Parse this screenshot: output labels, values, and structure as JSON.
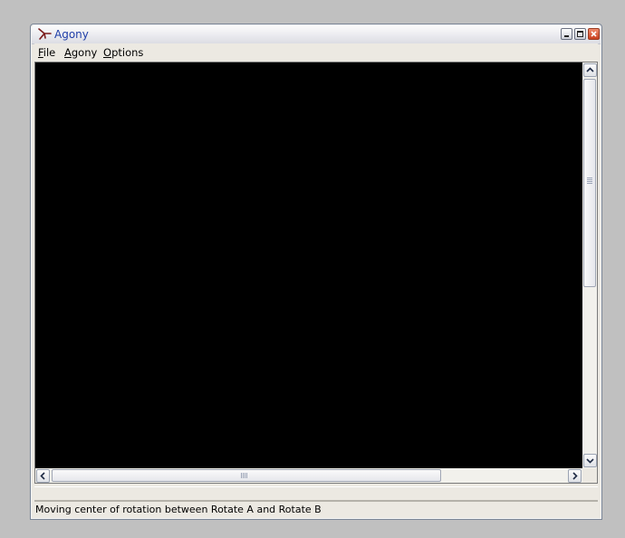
{
  "window": {
    "title": "Agony",
    "icon": "agony-app-icon"
  },
  "titlebar_buttons": {
    "minimize": "minimize-icon",
    "maximize": "maximize-icon",
    "close": "close-icon"
  },
  "menu": {
    "items": [
      {
        "accel": "F",
        "rest": "ile"
      },
      {
        "accel": "A",
        "rest": "gony"
      },
      {
        "accel": "O",
        "rest": "ptions"
      }
    ]
  },
  "canvas": {
    "background": "#000000"
  },
  "scrollbars": {
    "vertical_up": "chevron-up-icon",
    "vertical_down": "chevron-down-icon",
    "horizontal_left": "chevron-left-icon",
    "horizontal_right": "chevron-right-icon"
  },
  "status": {
    "text": "Moving center of rotation between Rotate A and Rotate B"
  }
}
